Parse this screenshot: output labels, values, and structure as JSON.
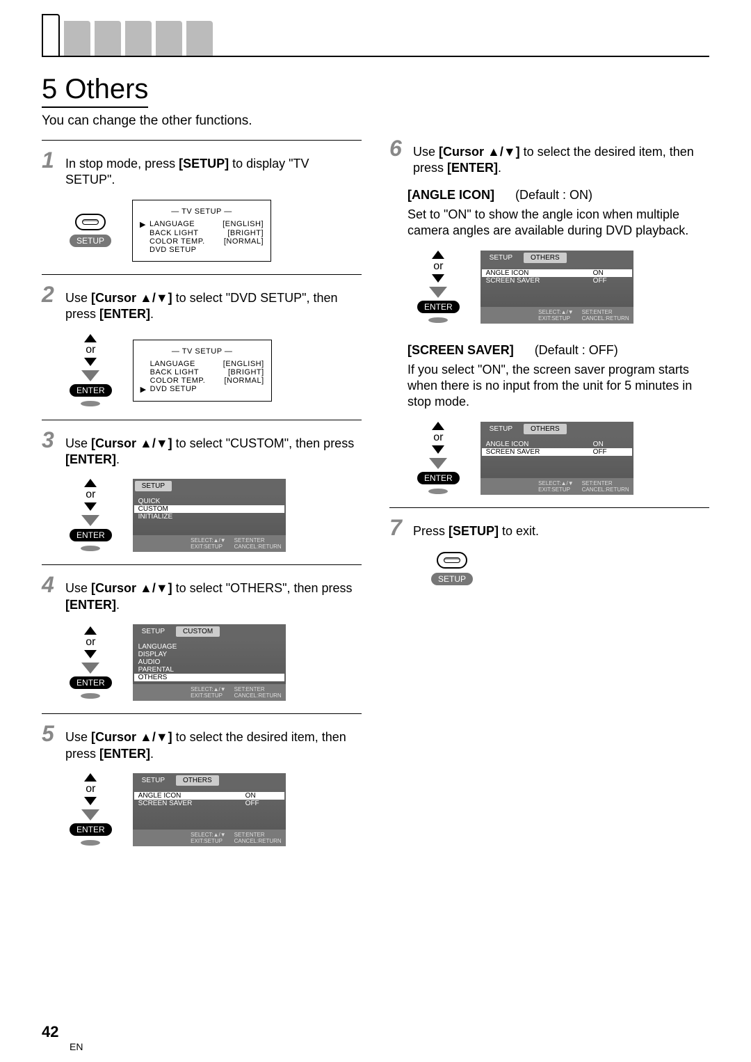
{
  "section": {
    "num": "5",
    "title": "Others"
  },
  "intro": "You can change the other functions.",
  "steps": {
    "s1": {
      "num": "1",
      "text_a": "In stop mode, press ",
      "bold": "[SETUP]",
      "text_b": " to display \"TV SETUP\"."
    },
    "s2": {
      "num": "2",
      "text_a": "Use ",
      "bold": "[Cursor ▲/▼]",
      "text_b": " to select \"DVD SETUP\", then press ",
      "bold2": "[ENTER]",
      "tail": "."
    },
    "s3": {
      "num": "3",
      "text_a": "Use ",
      "bold": "[Cursor ▲/▼]",
      "text_b": " to select \"CUSTOM\", then press ",
      "bold2": "[ENTER]",
      "tail": "."
    },
    "s4": {
      "num": "4",
      "text_a": "Use ",
      "bold": "[Cursor ▲/▼]",
      "text_b": " to select \"OTHERS\", then press ",
      "bold2": "[ENTER]",
      "tail": "."
    },
    "s5": {
      "num": "5",
      "text_a": "Use ",
      "bold": "[Cursor ▲/▼]",
      "text_b": " to select the desired item, then press ",
      "bold2": "[ENTER]",
      "tail": "."
    },
    "s6": {
      "num": "6",
      "text_a": "Use ",
      "bold": "[Cursor ▲/▼]",
      "text_b": " to select the desired item, then press ",
      "bold2": "[ENTER]",
      "tail": "."
    },
    "s7": {
      "num": "7",
      "text_a": "Press ",
      "bold": "[SETUP]",
      "text_b": " to exit."
    }
  },
  "ctrl": {
    "or": "or",
    "enter": "ENTER",
    "setup": "SETUP"
  },
  "osd_tv": {
    "title": "—  TV SETUP  —",
    "rows": [
      {
        "arrow": "▶",
        "label": "LANGUAGE",
        "val": "[ENGLISH]"
      },
      {
        "arrow": "",
        "label": "BACK LIGHT",
        "val": "[BRIGHT]"
      },
      {
        "arrow": "",
        "label": "COLOR TEMP.",
        "val": "[NORMAL]"
      },
      {
        "arrow": "",
        "label": "DVD SETUP",
        "val": ""
      }
    ]
  },
  "osd_tv2": {
    "title": "—  TV SETUP  —",
    "rows": [
      {
        "arrow": "",
        "label": "LANGUAGE",
        "val": "[ENGLISH]"
      },
      {
        "arrow": "",
        "label": "BACK LIGHT",
        "val": "[BRIGHT]"
      },
      {
        "arrow": "",
        "label": "COLOR TEMP.",
        "val": "[NORMAL]"
      },
      {
        "arrow": "▶",
        "label": "DVD SETUP",
        "val": ""
      }
    ]
  },
  "osd_setup": {
    "tab": "SETUP",
    "items": [
      "QUICK",
      "CUSTOM",
      "INITIALIZE"
    ],
    "sel": 1,
    "foot_l": "SELECT:▲/▼\nEXIT:SETUP",
    "foot_r": "SET:ENTER\nCANCEL:RETURN"
  },
  "osd_custom": {
    "tab_l": "SETUP",
    "tab_r": "CUSTOM",
    "items": [
      "LANGUAGE",
      "DISPLAY",
      "AUDIO",
      "PARENTAL",
      "OTHERS"
    ],
    "sel": 4,
    "foot_l": "SELECT:▲/▼\nEXIT:SETUP",
    "foot_r": "SET:ENTER\nCANCEL:RETURN"
  },
  "osd_others_angle": {
    "tab_l": "SETUP",
    "tab_r": "OTHERS",
    "rows": [
      {
        "l": "ANGLE ICON",
        "r": "ON",
        "sel": true
      },
      {
        "l": "SCREEN SAVER",
        "r": "OFF",
        "sel": false
      }
    ],
    "foot_l": "SELECT:▲/▼\nEXIT:SETUP",
    "foot_r": "SET:ENTER\nCANCEL:RETURN"
  },
  "osd_others_saver": {
    "tab_l": "SETUP",
    "tab_r": "OTHERS",
    "rows": [
      {
        "l": "ANGLE ICON",
        "r": "ON",
        "sel": false
      },
      {
        "l": "SCREEN SAVER",
        "r": "OFF",
        "sel": true
      }
    ],
    "foot_l": "SELECT:▲/▼\nEXIT:SETUP",
    "foot_r": "SET:ENTER\nCANCEL:RETURN"
  },
  "settings": {
    "angle": {
      "name": "[ANGLE ICON]",
      "def": "(Default : ON)",
      "desc": "Set to \"ON\" to show the angle icon when multiple camera angles are available during DVD playback."
    },
    "saver": {
      "name": "[SCREEN SAVER]",
      "def": "(Default : OFF)",
      "desc": "If you select \"ON\", the screen saver program starts when there is no input from the unit for 5 minutes in stop mode."
    }
  },
  "page": {
    "num": "42",
    "lang": "EN"
  }
}
